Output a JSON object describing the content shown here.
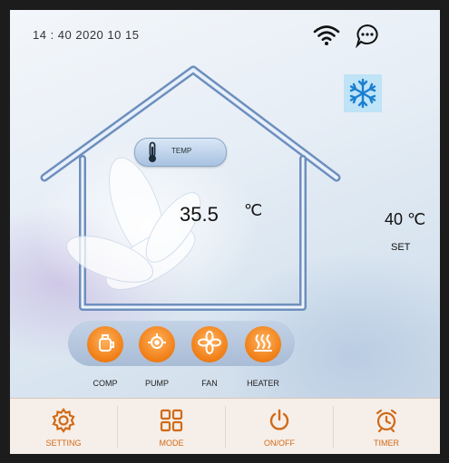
{
  "status_bar": {
    "datetime": "14 : 40 2020 10 15"
  },
  "indicators": {
    "wifi_icon": "wifi-icon",
    "message_icon": "chat-bubble-icon",
    "mode_icon": "snowflake-icon"
  },
  "temperature": {
    "label": "TEMP",
    "current": "35.5",
    "unit": "℃",
    "set_value": "40 ℃",
    "set_label": "SET"
  },
  "components": [
    {
      "label": "COMP"
    },
    {
      "label": "PUMP"
    },
    {
      "label": "FAN"
    },
    {
      "label": "HEATER"
    }
  ],
  "toolbar": [
    {
      "label": "SETTING"
    },
    {
      "label": "MODE"
    },
    {
      "label": "ON/OFF"
    },
    {
      "label": "TIMER"
    }
  ],
  "colors": {
    "accent": "#f07d14",
    "button_text": "#d06a18",
    "house_outline": "#7f9cc6"
  }
}
